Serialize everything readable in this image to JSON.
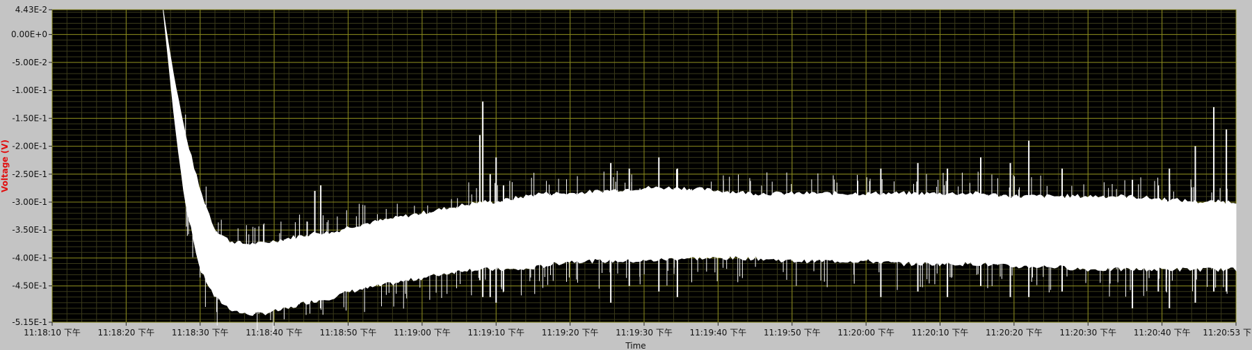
{
  "chart_data": {
    "type": "line",
    "title": "",
    "xlabel": "Time",
    "ylabel": "Voltage (V)",
    "ylim": [
      -0.515,
      0.0443
    ],
    "y_ticks": [
      {
        "value": 0.0443,
        "label": "4.43E-2"
      },
      {
        "value": 0.0,
        "label": "0.00E+0"
      },
      {
        "value": -0.05,
        "label": "-5.00E-2"
      },
      {
        "value": -0.1,
        "label": "-1.00E-1"
      },
      {
        "value": -0.15,
        "label": "-1.50E-1"
      },
      {
        "value": -0.2,
        "label": "-2.00E-1"
      },
      {
        "value": -0.25,
        "label": "-2.50E-1"
      },
      {
        "value": -0.3,
        "label": "-3.00E-1"
      },
      {
        "value": -0.35,
        "label": "-3.50E-1"
      },
      {
        "value": -0.4,
        "label": "-4.00E-1"
      },
      {
        "value": -0.45,
        "label": "-4.50E-1"
      },
      {
        "value": -0.515,
        "label": "-5.15E-1"
      }
    ],
    "x_ticks": [
      {
        "value": 0,
        "label": "11:18:10 下午"
      },
      {
        "value": 10,
        "label": "11:18:20 下午"
      },
      {
        "value": 20,
        "label": "11:18:30 下午"
      },
      {
        "value": 30,
        "label": "11:18:40 下午"
      },
      {
        "value": 40,
        "label": "11:18:50 下午"
      },
      {
        "value": 50,
        "label": "11:19:00 下午"
      },
      {
        "value": 60,
        "label": "11:19:10 下午"
      },
      {
        "value": 70,
        "label": "11:19:20 下午"
      },
      {
        "value": 80,
        "label": "11:19:30 下午"
      },
      {
        "value": 90,
        "label": "11:19:40 下午"
      },
      {
        "value": 100,
        "label": "11:19:50 下午"
      },
      {
        "value": 110,
        "label": "11:20:00 下午"
      },
      {
        "value": 120,
        "label": "11:20:10 下午"
      },
      {
        "value": 130,
        "label": "11:20:20 下午"
      },
      {
        "value": 140,
        "label": "11:20:30 下午"
      },
      {
        "value": 150,
        "label": "11:20:40 下午"
      },
      {
        "value": 160,
        "label": "11:20:53 下"
      }
    ],
    "xlim": [
      0,
      160
    ],
    "grid": true,
    "series": [
      {
        "color": "#ffffff",
        "x": [
          15,
          15.5,
          16.5,
          18,
          20,
          22,
          24,
          26,
          28,
          30,
          32,
          34,
          36,
          38,
          40,
          42,
          44,
          46,
          48,
          50,
          52,
          54,
          56,
          58,
          60,
          62,
          64,
          66,
          68,
          70,
          75,
          80,
          85,
          90,
          95,
          100,
          105,
          110,
          115,
          120,
          125,
          130,
          135,
          140,
          145,
          150,
          155,
          160
        ],
        "upper": [
          0.044,
          0.0,
          -0.08,
          -0.18,
          -0.28,
          -0.35,
          -0.37,
          -0.375,
          -0.375,
          -0.37,
          -0.365,
          -0.36,
          -0.355,
          -0.355,
          -0.345,
          -0.34,
          -0.335,
          -0.33,
          -0.325,
          -0.32,
          -0.315,
          -0.31,
          -0.305,
          -0.3,
          -0.3,
          -0.295,
          -0.29,
          -0.285,
          -0.285,
          -0.285,
          -0.28,
          -0.275,
          -0.275,
          -0.28,
          -0.285,
          -0.285,
          -0.285,
          -0.285,
          -0.285,
          -0.285,
          -0.285,
          -0.29,
          -0.29,
          -0.29,
          -0.29,
          -0.295,
          -0.3,
          -0.3
        ],
        "lower": [
          0.044,
          -0.02,
          -0.15,
          -0.3,
          -0.42,
          -0.47,
          -0.49,
          -0.5,
          -0.5,
          -0.495,
          -0.49,
          -0.48,
          -0.475,
          -0.47,
          -0.46,
          -0.455,
          -0.45,
          -0.445,
          -0.44,
          -0.435,
          -0.43,
          -0.425,
          -0.42,
          -0.42,
          -0.42,
          -0.42,
          -0.42,
          -0.415,
          -0.41,
          -0.405,
          -0.405,
          -0.405,
          -0.4,
          -0.4,
          -0.4,
          -0.405,
          -0.405,
          -0.405,
          -0.41,
          -0.41,
          -0.41,
          -0.415,
          -0.415,
          -0.42,
          -0.42,
          -0.42,
          -0.42,
          -0.42
        ],
        "spikes": [
          {
            "x": 35.5,
            "top": -0.28,
            "bottom": -0.48
          },
          {
            "x": 36.3,
            "top": -0.27,
            "bottom": -0.49
          },
          {
            "x": 57.8,
            "top": -0.18,
            "bottom": -0.44
          },
          {
            "x": 58.2,
            "top": -0.12,
            "bottom": -0.47
          },
          {
            "x": 59.2,
            "top": -0.25,
            "bottom": -0.47
          },
          {
            "x": 60.0,
            "top": -0.22,
            "bottom": -0.48
          },
          {
            "x": 61.0,
            "top": -0.27,
            "bottom": -0.46
          },
          {
            "x": 75.5,
            "top": -0.23,
            "bottom": -0.48
          },
          {
            "x": 78.0,
            "top": -0.24,
            "bottom": -0.45
          },
          {
            "x": 82.0,
            "top": -0.22,
            "bottom": -0.46
          },
          {
            "x": 84.5,
            "top": -0.24,
            "bottom": -0.47
          },
          {
            "x": 112.0,
            "top": -0.24,
            "bottom": -0.47
          },
          {
            "x": 117.0,
            "top": -0.23,
            "bottom": -0.46
          },
          {
            "x": 121.0,
            "top": -0.24,
            "bottom": -0.47
          },
          {
            "x": 125.5,
            "top": -0.22,
            "bottom": -0.45
          },
          {
            "x": 129.5,
            "top": -0.23,
            "bottom": -0.47
          },
          {
            "x": 132.0,
            "top": -0.19,
            "bottom": -0.47
          },
          {
            "x": 136.5,
            "top": -0.24,
            "bottom": -0.46
          },
          {
            "x": 146.0,
            "top": -0.26,
            "bottom": -0.49
          },
          {
            "x": 149.5,
            "top": -0.27,
            "bottom": -0.46
          },
          {
            "x": 151.0,
            "top": -0.24,
            "bottom": -0.49
          },
          {
            "x": 154.5,
            "top": -0.2,
            "bottom": -0.48
          },
          {
            "x": 157.0,
            "top": -0.13,
            "bottom": -0.46
          },
          {
            "x": 158.7,
            "top": -0.17,
            "bottom": -0.46
          }
        ]
      }
    ]
  }
}
